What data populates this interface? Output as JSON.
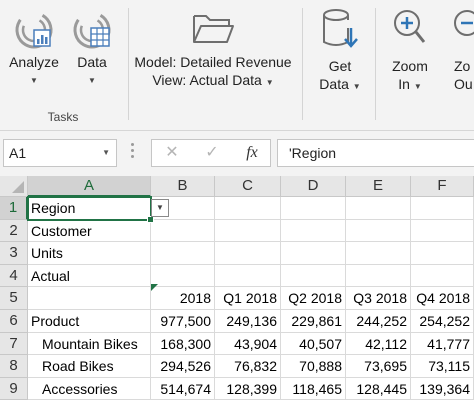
{
  "ribbon": {
    "buttons": [
      {
        "id": "analyze",
        "label": "Analyze",
        "icon": "analyze-icon",
        "has_dropdown": true
      },
      {
        "id": "data",
        "label": "Data",
        "icon": "data-grid-icon",
        "has_dropdown": true
      },
      {
        "id": "model",
        "line1": "Model: Detailed Revenue",
        "line2": "View: Actual Data",
        "icon": "folder-icon",
        "has_dropdown": true
      },
      {
        "id": "get-data",
        "line1": "Get",
        "line2": "Data",
        "icon": "database-download-icon",
        "has_dropdown": true
      },
      {
        "id": "zoom-in",
        "line1": "Zoom",
        "line2": "In",
        "icon": "zoom-in-icon",
        "has_dropdown": true
      },
      {
        "id": "zoom-out",
        "line1": "Zo",
        "line2": "Ou",
        "icon": "zoom-out-icon",
        "has_dropdown": false
      }
    ],
    "group_label": "Tasks",
    "accent": "#4a7ebb"
  },
  "formula_bar": {
    "name_box": "A1",
    "cancel_glyph": "✕",
    "enter_glyph": "✓",
    "fx_glyph": "fx",
    "content": "'Region"
  },
  "grid": {
    "columns": [
      "A",
      "B",
      "C",
      "D",
      "E",
      "F"
    ],
    "selected_column": "A",
    "rows": [
      {
        "num": "1",
        "cells": [
          "Region",
          "",
          "",
          "",
          "",
          ""
        ]
      },
      {
        "num": "2",
        "cells": [
          "Customer",
          "",
          "",
          "",
          "",
          ""
        ]
      },
      {
        "num": "3",
        "cells": [
          "Units",
          "",
          "",
          "",
          "",
          ""
        ]
      },
      {
        "num": "4",
        "cells": [
          "Actual",
          "",
          "",
          "",
          "",
          ""
        ]
      },
      {
        "num": "5",
        "cells": [
          "",
          "2018",
          "Q1 2018",
          "Q2 2018",
          "Q3 2018",
          "Q4 2018"
        ]
      },
      {
        "num": "6",
        "cells": [
          "Product",
          "977,500",
          "249,136",
          "229,861",
          "244,252",
          "254,252"
        ]
      },
      {
        "num": "7",
        "cells": [
          "Mountain Bikes",
          "168,300",
          "43,904",
          "40,507",
          "42,112",
          "41,777"
        ]
      },
      {
        "num": "8",
        "cells": [
          "Road Bikes",
          "294,526",
          "76,832",
          "70,888",
          "73,695",
          "73,115"
        ]
      },
      {
        "num": "9",
        "cells": [
          "Accessories",
          "514,674",
          "128,399",
          "118,465",
          "128,445",
          "139,364"
        ]
      }
    ],
    "selected_row": "1",
    "active_cell": "A1",
    "selection_color": "#217346"
  }
}
